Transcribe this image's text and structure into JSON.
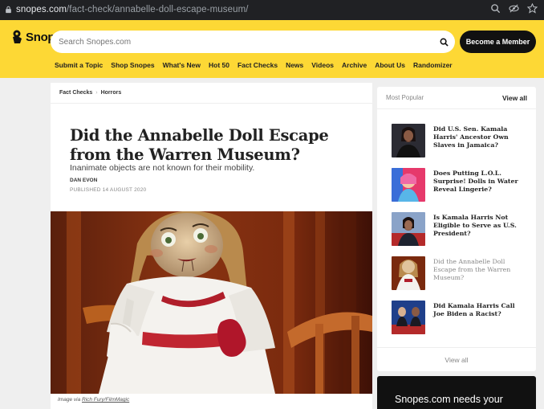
{
  "browser": {
    "domain": "snopes.com",
    "path": "/fact-check/annabelle-doll-escape-museum/"
  },
  "header": {
    "logo_text": "Snopes",
    "search_placeholder": "Search Snopes.com",
    "member_button": "Become a Member",
    "nav": [
      "Submit a Topic",
      "Shop Snopes",
      "What's New",
      "Hot 50",
      "Fact Checks",
      "News",
      "Videos",
      "Archive",
      "About Us",
      "Randomizer"
    ]
  },
  "article": {
    "breadcrumb": [
      "Fact Checks",
      "Horrors"
    ],
    "title": "Did the Annabelle Doll Escape from the Warren Museum?",
    "subtitle": "Inanimate objects are not known for their mobility.",
    "author": "DAN EVON",
    "published": "PUBLISHED 14 AUGUST 2020",
    "caption_prefix": "Image via",
    "caption_link": "Rich Fury/FilmMagic"
  },
  "sidebar": {
    "heading": "Most Popular",
    "view_all_top": "View all",
    "view_all_bottom": "View all",
    "items": [
      {
        "title": "Did U.S. Sen. Kamala Harris' Ancestor Own Slaves in Jamaica?",
        "visited": false
      },
      {
        "title": "Does Putting L.O.L. Surprise! Dolls in Water Reveal Lingerie?",
        "visited": false
      },
      {
        "title": "Is Kamala Harris Not Eligible to Serve as U.S. President?",
        "visited": false
      },
      {
        "title": "Did the Annabelle Doll Escape from the Warren Museum?",
        "visited": true
      },
      {
        "title": "Did Kamala Harris Call Joe Biden a Racist?",
        "visited": false
      }
    ]
  },
  "promo": {
    "text": "Snopes.com needs your"
  },
  "colors": {
    "brand_yellow": "#fdd835",
    "browser_bar": "#202124"
  }
}
